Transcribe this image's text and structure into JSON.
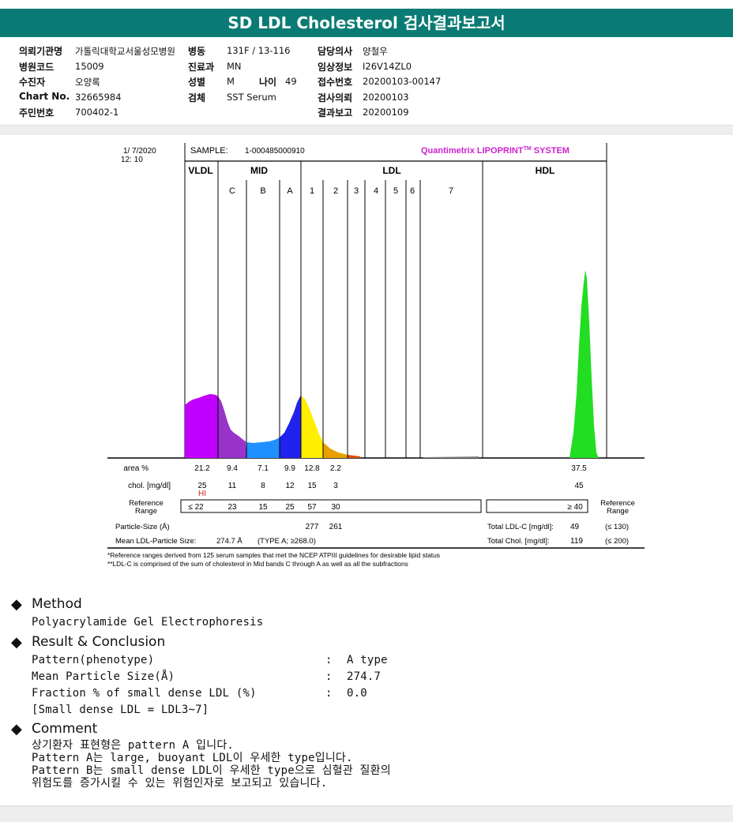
{
  "header": {
    "title": "SD LDL Cholesterol 검사결과보고서"
  },
  "patient": {
    "hospital_label": "의뢰기관명",
    "hospital": "가톨릭대학교서울성모병원",
    "ward_label": "병동",
    "ward": "131F / 13-116",
    "doctor_label": "담당의사",
    "doctor": "양철우",
    "code_label": "병원코드",
    "code": "15009",
    "dept_label": "진료과",
    "dept": "MN",
    "clinical_label": "임상정보",
    "clinical": "I26V14ZL0",
    "name_label": "수진자",
    "name": "오양록",
    "sex_label": "성별",
    "sex": "M",
    "age_label": "나이",
    "age": "49",
    "receipt_label": "접수번호",
    "receipt": "20200103-00147",
    "chart_label": "Chart No.",
    "chart": "32665984",
    "specimen_label": "검체",
    "specimen": "SST Serum",
    "request_label": "검사의뢰",
    "request": "20200103",
    "id_label": "주민번호",
    "id": "700402-1",
    "report_label": "결과보고",
    "report": "20200109"
  },
  "chart_data": {
    "type": "area",
    "date": "1/ 7/2020",
    "time": "12: 10",
    "sample_label": "SAMPLE:",
    "sample": "1-000485000910",
    "brand": "Quantimetrix LIPOPRINT",
    "brand_tm": "TM",
    "brand_suffix": " SYSTEM",
    "groups": [
      "VLDL",
      "MID",
      "LDL",
      "HDL"
    ],
    "bands": [
      "C",
      "B",
      "A",
      "1",
      "2",
      "3",
      "4",
      "5",
      "6",
      "7"
    ],
    "fractions": [
      "VLDL",
      "C",
      "B",
      "A",
      "LDL1",
      "LDL2",
      "LDL3",
      "LDL4",
      "LDL5",
      "LDL6",
      "LDL7",
      "HDL"
    ],
    "colors": {
      "VLDL": "#c000ff",
      "C": "#9933cc",
      "B": "#1e90ff",
      "A": "#2222ee",
      "LDL1": "#ffee00",
      "LDL2": "#e8a000",
      "LDL3": "#e05000",
      "HDL": "#22dd22"
    },
    "area_label": "area %",
    "area": [
      "21.2",
      "9.4",
      "7.1",
      "9.9",
      "12.8",
      "2.2",
      "",
      "",
      "",
      "",
      "",
      "37.5"
    ],
    "chol_label": "chol. [mg/dl]",
    "chol": [
      "25",
      "11",
      "8",
      "12",
      "15",
      "3",
      "",
      "",
      "",
      "",
      "",
      "45"
    ],
    "chol_flag": "HI",
    "ref_label": "Reference Range",
    "ref_left": [
      "≤ 22",
      "23",
      "15",
      "25",
      "57",
      "30"
    ],
    "ref_hdl": "≥ 40",
    "ref_right_label": "Reference Range",
    "particle_label": "Particle-Size (Å)",
    "particle": [
      "277",
      "261"
    ],
    "total_ldl_label": "Total LDL-C [mg/dl]:",
    "total_ldl": "49",
    "total_ldl_ref": "(≤ 130)",
    "mean_label": "Mean LDL-Particle Size:",
    "mean": "274.7 Å",
    "mean_type": "(TYPE A; ≥268.0)",
    "total_chol_label": "Total Chol. [mg/dl]:",
    "total_chol": "119",
    "total_chol_ref": "(≤ 200)",
    "footnote1": "*Reference ranges derived from 125 serum samples that met the NCEP ATPIII guidelines for desirable lipid status",
    "footnote2": "**LDL-C is comprised of the sum of cholesterol in Mid bands C through A as well as all the subfractions"
  },
  "method": {
    "title": "Method",
    "text": "Polyacrylamide Gel Electrophoresis"
  },
  "result": {
    "title": "Result & Conclusion",
    "rows": [
      {
        "label": "Pattern(phenotype)",
        "value": "A type"
      },
      {
        "label": "Mean Particle Size(Å)",
        "value": "274.7"
      },
      {
        "label": "Fraction % of small dense LDL (%)",
        "value": "0.0"
      }
    ],
    "note": "[Small dense LDL = LDL3~7]",
    "colon": ":"
  },
  "comment": {
    "title": "Comment",
    "lines": [
      "상기환자 표현형은 pattern A 입니다.",
      "Pattern A는 large, buoyant LDL이 우세한 type입니다.",
      "Pattern B는 small dense LDL이 우세한 type으로 심혈관 질환의",
      "위험도를 증가시킬 수 있는 위험인자로 보고되고 있습니다."
    ]
  },
  "icons": {
    "bullet": "diamond-icon"
  }
}
